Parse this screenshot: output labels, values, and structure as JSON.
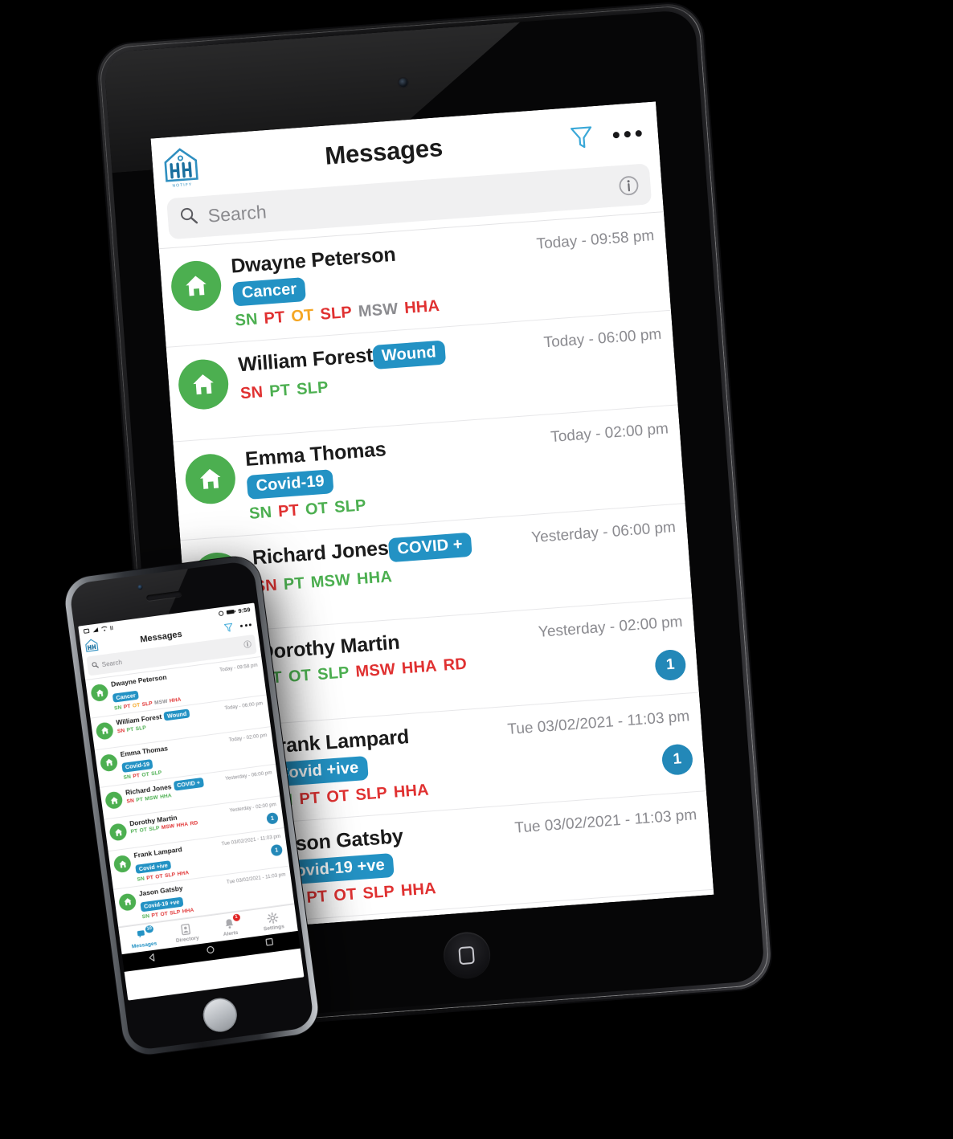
{
  "app": {
    "title": "Messages",
    "logo_alt": "HH Notify house logo",
    "search_placeholder": "Search",
    "search_value": ""
  },
  "header_actions": [
    {
      "name": "filter-icon",
      "label": "Filter"
    },
    {
      "name": "overflow-menu-icon",
      "label": "More"
    }
  ],
  "messages": [
    {
      "name": "Dwayne Peterson",
      "tag": "Cancer",
      "tag_inline": false,
      "time": "Today - 09:58 pm",
      "badge": "",
      "disciplines": [
        {
          "text": "SN",
          "color": "green"
        },
        {
          "text": "PT",
          "color": "red"
        },
        {
          "text": "OT",
          "color": "orange"
        },
        {
          "text": "SLP",
          "color": "red"
        },
        {
          "text": "MSW",
          "color": "gray"
        },
        {
          "text": "HHA",
          "color": "red"
        }
      ]
    },
    {
      "name": "William Forest",
      "tag": "Wound",
      "tag_inline": true,
      "time": "Today - 06:00 pm",
      "badge": "",
      "disciplines": [
        {
          "text": "SN",
          "color": "red"
        },
        {
          "text": "PT",
          "color": "green"
        },
        {
          "text": "SLP",
          "color": "green"
        }
      ]
    },
    {
      "name": "Emma Thomas",
      "tag": "Covid-19",
      "tag_inline": false,
      "time": "Today - 02:00 pm",
      "badge": "",
      "disciplines": [
        {
          "text": "SN",
          "color": "green"
        },
        {
          "text": "PT",
          "color": "red"
        },
        {
          "text": "OT",
          "color": "green"
        },
        {
          "text": "SLP",
          "color": "green"
        }
      ]
    },
    {
      "name": "Richard Jones",
      "tag": "COVID +",
      "tag_inline": true,
      "time": "Yesterday - 06:00 pm",
      "badge": "",
      "disciplines": [
        {
          "text": "SN",
          "color": "red"
        },
        {
          "text": "PT",
          "color": "green"
        },
        {
          "text": "MSW",
          "color": "green"
        },
        {
          "text": "HHA",
          "color": "green"
        }
      ]
    },
    {
      "name": "Dorothy Martin",
      "tag": "",
      "tag_inline": true,
      "time": "Yesterday - 02:00 pm",
      "badge": "1",
      "disciplines": [
        {
          "text": "PT",
          "color": "green"
        },
        {
          "text": "OT",
          "color": "green"
        },
        {
          "text": "SLP",
          "color": "green"
        },
        {
          "text": "MSW",
          "color": "red"
        },
        {
          "text": "HHA",
          "color": "red"
        },
        {
          "text": "RD",
          "color": "red"
        }
      ]
    },
    {
      "name": "Frank Lampard",
      "tag": "Covid +ive",
      "tag_inline": false,
      "time": "Tue 03/02/2021 - 11:03 pm",
      "badge": "1",
      "disciplines": [
        {
          "text": "SN",
          "color": "green"
        },
        {
          "text": "PT",
          "color": "red"
        },
        {
          "text": "OT",
          "color": "red"
        },
        {
          "text": "SLP",
          "color": "red"
        },
        {
          "text": "HHA",
          "color": "red"
        }
      ]
    },
    {
      "name": "Jason Gatsby",
      "tag": "Covid-19 +ve",
      "tag_inline": false,
      "time": "Tue 03/02/2021 - 11:03 pm",
      "badge": "",
      "disciplines": [
        {
          "text": "SN",
          "color": "green"
        },
        {
          "text": "PT",
          "color": "red"
        },
        {
          "text": "OT",
          "color": "red"
        },
        {
          "text": "SLP",
          "color": "red"
        },
        {
          "text": "HHA",
          "color": "red"
        }
      ]
    }
  ],
  "phone": {
    "status_time": "9:59",
    "nav": [
      {
        "label": "Messages",
        "icon": "chat-icon",
        "badge": "10",
        "badge_style": "blue",
        "active": true
      },
      {
        "label": "Directory",
        "icon": "contacts-icon",
        "badge": "",
        "badge_style": "",
        "active": false
      },
      {
        "label": "Alerts",
        "icon": "bell-icon",
        "badge": "1",
        "badge_style": "red",
        "active": false
      },
      {
        "label": "Settings",
        "icon": "gear-icon",
        "badge": "",
        "badge_style": "",
        "active": false
      }
    ],
    "system_nav": [
      "back-button",
      "home-button",
      "recents-button"
    ]
  },
  "colors": {
    "accent_blue": "#2392c4",
    "badge_blue": "#2388b8",
    "avatar_green": "#4caf50",
    "disc_green": "#4caf50",
    "disc_red": "#e03131",
    "disc_orange": "#f5a623",
    "disc_gray": "#8c8c90",
    "alert_red": "#e02424"
  }
}
